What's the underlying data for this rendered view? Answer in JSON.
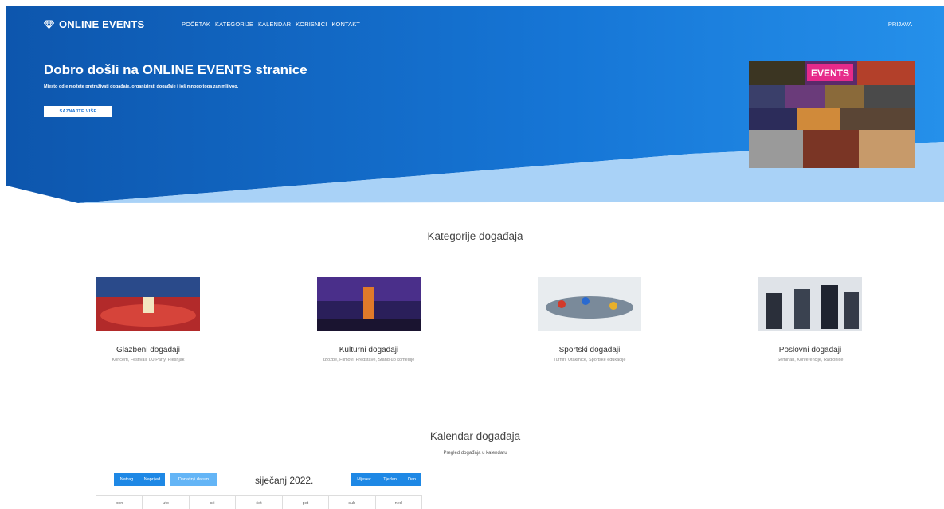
{
  "brand": {
    "name": "ONLINE EVENTS",
    "icon": "diamond-icon"
  },
  "nav": {
    "items": [
      "POČETAK",
      "KATEGORIJE",
      "KALENDAR",
      "KORISNICI",
      "KONTAKT"
    ],
    "login": "PRIJAVA"
  },
  "hero": {
    "title": "Dobro došli na ONLINE EVENTS stranice",
    "subtitle": "Mjesto gdje možete pretraživati događaje, organizirati događaje i još mnogo toga zanimljivog.",
    "button": "SAZNAJTE VIŠE",
    "collage_text": "EVENTS"
  },
  "categories": {
    "title": "Kategorije događaja",
    "items": [
      {
        "name": "Glazbeni događaji",
        "desc": "Koncerti, Festivali, DJ Party, Plesnjak"
      },
      {
        "name": "Kulturni događaji",
        "desc": "Izložbe, Filmovi, Predstave, Stand-up komedije"
      },
      {
        "name": "Sportski događaji",
        "desc": "Turniri, Utakmice, Sportske edukacije"
      },
      {
        "name": "Poslovni događaji",
        "desc": "Seminari, Konferencije, Radionice"
      }
    ]
  },
  "calendar": {
    "title": "Kalendar događaja",
    "subtitle": "Pregled događaja u kalendaru",
    "prev": "Natrag",
    "next": "Naprijed",
    "today": "Današnji datum",
    "month": "siječanj 2022.",
    "views": [
      "Mjesec",
      "Tjedan",
      "Dan"
    ],
    "days": [
      "pon",
      "uto",
      "sri",
      "čet",
      "pet",
      "sub",
      "ned"
    ]
  },
  "colors": {
    "primary": "#1e88e5",
    "hero_dark": "#0d5cb6",
    "hero_light": "#a9d2f7"
  }
}
